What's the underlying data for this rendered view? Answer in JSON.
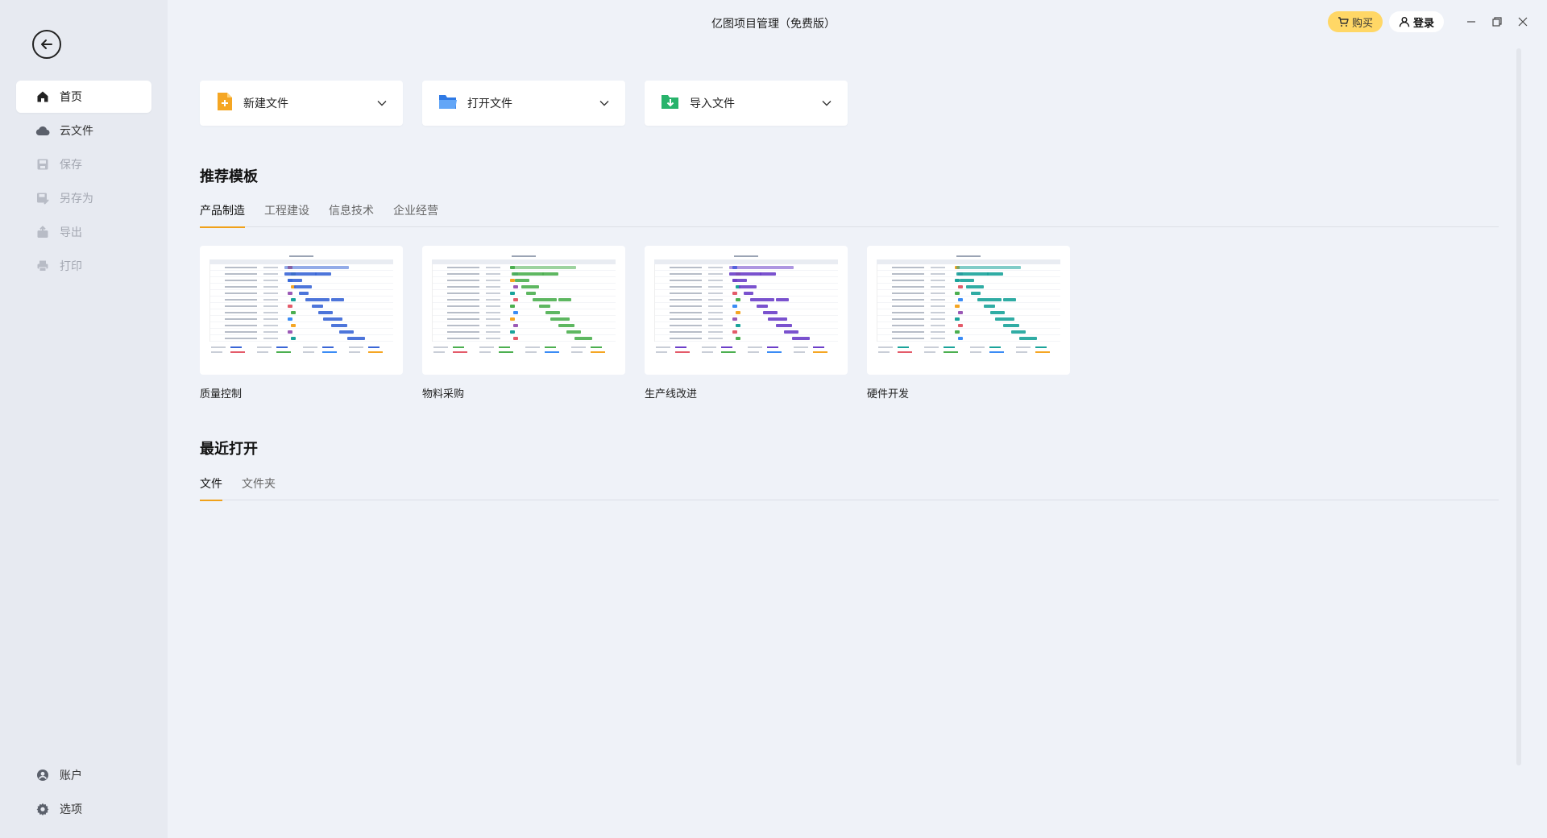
{
  "app": {
    "title": "亿图项目管理（免费版）"
  },
  "topbar": {
    "buy_label": "购买",
    "login_label": "登录",
    "accent": "#ffd766"
  },
  "sidebar": {
    "items": [
      {
        "label": "首页",
        "icon": "home-icon",
        "active": true,
        "disabled": false
      },
      {
        "label": "云文件",
        "icon": "cloud-icon",
        "active": false,
        "disabled": false
      },
      {
        "label": "保存",
        "icon": "save-icon",
        "active": false,
        "disabled": true
      },
      {
        "label": "另存为",
        "icon": "save-as-icon",
        "active": false,
        "disabled": true
      },
      {
        "label": "导出",
        "icon": "export-icon",
        "active": false,
        "disabled": true
      },
      {
        "label": "打印",
        "icon": "print-icon",
        "active": false,
        "disabled": true
      }
    ],
    "bottom_items": [
      {
        "label": "账户",
        "icon": "account-icon"
      },
      {
        "label": "选项",
        "icon": "gear-icon"
      }
    ]
  },
  "file_actions": [
    {
      "label": "新建文件",
      "icon": "new-file-icon",
      "color": "#f5a623"
    },
    {
      "label": "打开文件",
      "icon": "folder-icon",
      "color": "#3b8cf5"
    },
    {
      "label": "导入文件",
      "icon": "import-icon",
      "color": "#27b36b"
    }
  ],
  "recommended": {
    "title": "推荐模板",
    "tabs": [
      "产品制造",
      "工程建设",
      "信息技术",
      "企业经营"
    ],
    "templates": [
      {
        "name": "质量控制",
        "bar_color": "#3a66d6"
      },
      {
        "name": "物料采购",
        "bar_color": "#4caf50"
      },
      {
        "name": "生产线改进",
        "bar_color": "#6c3fc9"
      },
      {
        "name": "硬件开发",
        "bar_color": "#1aa39a"
      }
    ]
  },
  "recent": {
    "title": "最近打开",
    "tabs": [
      "文件",
      "文件夹"
    ]
  },
  "colors": {
    "tab_underline": "#f0a11a",
    "background": "#eff2f8",
    "sidebar": "#e7eaf1"
  }
}
